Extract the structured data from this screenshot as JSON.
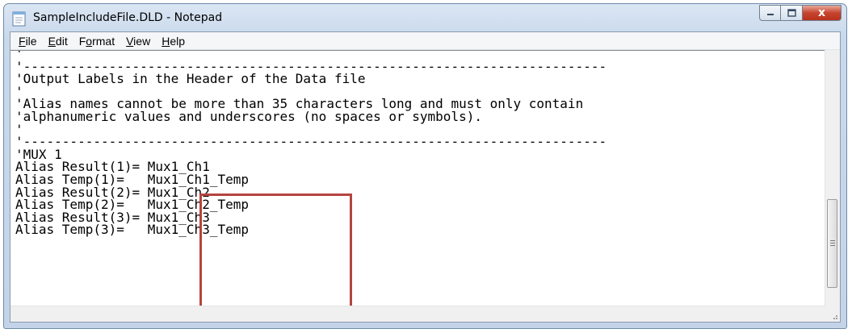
{
  "window": {
    "title": "SampleIncludeFile.DLD - Notepad",
    "close_glyph": "x",
    "min_glyph": "",
    "max_glyph": ""
  },
  "menu": {
    "items": [
      {
        "label_u": "F",
        "label_rest": "ile"
      },
      {
        "label_u": "E",
        "label_rest": "dit"
      },
      {
        "label_pre": "F",
        "label_u": "o",
        "label_rest": "rmat"
      },
      {
        "label_u": "V",
        "label_rest": "iew"
      },
      {
        "label_u": "H",
        "label_rest": "elp"
      }
    ]
  },
  "editor": {
    "lines": [
      "'",
      "'---------------------------------------------------------------------------",
      "'Output Labels in the Header of the Data file",
      "'",
      "'Alias names cannot be more than 35 characters long and must only contain",
      "'alphanumeric values and underscores (no spaces or symbols).",
      "'",
      "'---------------------------------------------------------------------------",
      "'MUX 1",
      "Alias Result(1)= Mux1_Ch1",
      "Alias Temp(1)=   Mux1_Ch1_Temp",
      "Alias Result(2)= Mux1_Ch2",
      "Alias Temp(2)=   Mux1_Ch2_Temp",
      "Alias Result(3)= Mux1_Ch3",
      "Alias Temp(3)=   Mux1_Ch3_Temp"
    ]
  },
  "colors": {
    "highlight_border": "#b5443e",
    "close_button": "#c7442e"
  },
  "icons": {
    "app": "notepad-icon",
    "minimize": "minimize-icon",
    "maximize": "maximize-icon",
    "close": "close-icon"
  }
}
